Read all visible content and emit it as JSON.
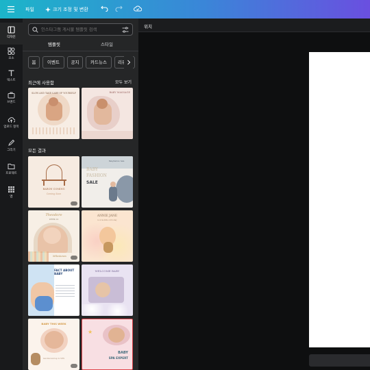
{
  "topbar": {
    "menu_icon": "hamburger-icon",
    "file_label": "파일",
    "resize_label": "크기 조정 및 변환",
    "undo_icon": "undo-icon",
    "redo_icon": "redo-icon",
    "cloud_icon": "cloud-sync-icon"
  },
  "rail": {
    "items": [
      {
        "label": "디자인",
        "icon": "layout-icon",
        "active": true
      },
      {
        "label": "요소",
        "icon": "shapes-icon"
      },
      {
        "label": "텍스트",
        "icon": "text-icon"
      },
      {
        "label": "브랜드",
        "icon": "briefcase-icon"
      },
      {
        "label": "업로드 항목",
        "icon": "cloud-upload-icon"
      },
      {
        "label": "그리기",
        "icon": "pen-icon"
      },
      {
        "label": "프로젝트",
        "icon": "folder-icon"
      },
      {
        "label": "앱",
        "icon": "apps-grid-icon"
      }
    ]
  },
  "panel": {
    "search": {
      "placeholder": "인스타그램 게시물 템플릿 검색",
      "icon": "search-icon",
      "filter_icon": "filter-sliders-icon"
    },
    "tabs": [
      {
        "label": "템플릿",
        "active": true
      },
      {
        "label": "스타일"
      }
    ],
    "chips": [
      "봄",
      "이벤트",
      "공지",
      "카드뉴스",
      "리뷰"
    ],
    "recent": {
      "title": "최근에 사용함",
      "see_all": "모두 보기"
    },
    "results_title": "모든 결과",
    "templates": {
      "r1a": "SLOW AND TAKE CARE OF YOURSELF",
      "r1b": "BABY MASSAGE",
      "g1a": "BARON COMING",
      "g1a_sub": "Coming Soon",
      "g1b_line1": "BABY",
      "g1b_line2": "FASHION",
      "g1b_line3": "SALE",
      "g1b_small": "Babyfashion Sale",
      "g2a_title": "Theodore",
      "g2a_sub": "WEEK 10",
      "g2a_footer": "Milestones",
      "g2b_title": "ANNIE JANE",
      "g2b_sub": "is 4 months old today",
      "g3a_title": "FACT ABOUT BABY",
      "g3b_title": "WELCOME BABY",
      "g4a_title": "BABY THIS WEEK",
      "g4a_footer": "Get discount up to 50%",
      "g4b_line1": "BABY",
      "g4b_line2": "SPA EXPERT"
    }
  },
  "canvas": {
    "position_label": "위치"
  },
  "colors": {
    "topbar_start": "#1cb5c9",
    "topbar_end": "#6a4fe0",
    "accent": "#8b6ff2",
    "selected_border": "#e0434a"
  }
}
